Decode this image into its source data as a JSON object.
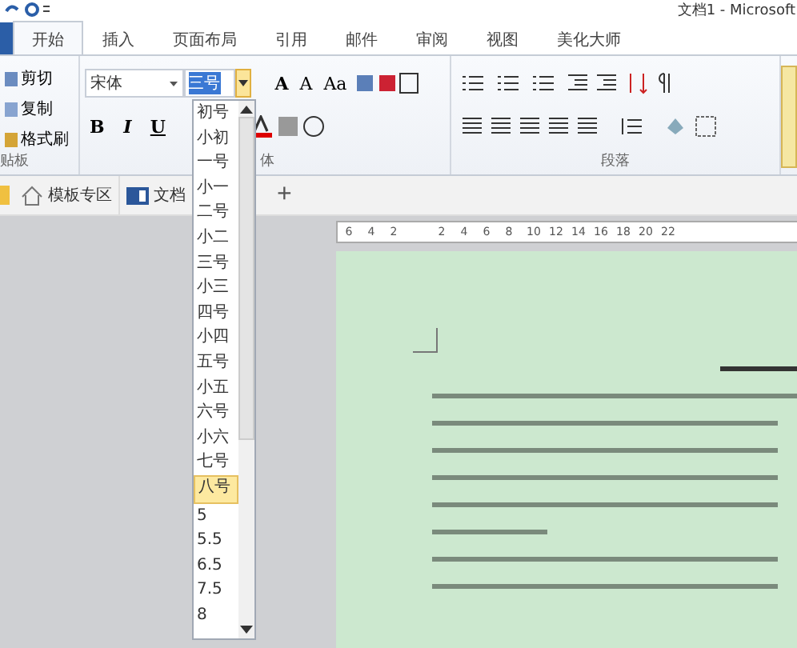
{
  "window": {
    "title": "文档1 - Microsoft"
  },
  "tabs": [
    {
      "label": "开始",
      "selected": true
    },
    {
      "label": "插入",
      "selected": false
    },
    {
      "label": "页面布局",
      "selected": false
    },
    {
      "label": "引用",
      "selected": false
    },
    {
      "label": "邮件",
      "selected": false
    },
    {
      "label": "审阅",
      "selected": false
    },
    {
      "label": "视图",
      "selected": false
    },
    {
      "label": "美化大师",
      "selected": false
    }
  ],
  "clipboard": {
    "items": [
      "剪切",
      "复制",
      "格式刷"
    ],
    "group_label": "贴板"
  },
  "font": {
    "name": "宋体",
    "size": "三号",
    "row1_tools": [
      "A",
      "A",
      "Aa"
    ],
    "row2_tools": [
      "B",
      "I",
      "U"
    ],
    "group_label": "体"
  },
  "paragraph": {
    "group_label": "段落"
  },
  "doc_tabs": [
    {
      "label": "模板专区",
      "kind": "home"
    },
    {
      "label": "文档",
      "kind": "word"
    }
  ],
  "new_tab": "+",
  "ruler": {
    "labels": [
      "6",
      "4",
      "2",
      "2",
      "4",
      "6",
      "8",
      "10",
      "12",
      "14",
      "16",
      "18",
      "20",
      "22"
    ]
  },
  "size_dropdown": {
    "items": [
      {
        "label": "初号",
        "selected": false
      },
      {
        "label": "小初",
        "selected": false
      },
      {
        "label": "一号",
        "selected": false
      },
      {
        "label": "小一",
        "selected": false
      },
      {
        "label": "二号",
        "selected": false
      },
      {
        "label": "小二",
        "selected": false
      },
      {
        "label": "三号",
        "selected": false
      },
      {
        "label": "小三",
        "selected": false
      },
      {
        "label": "四号",
        "selected": false
      },
      {
        "label": "小四",
        "selected": false
      },
      {
        "label": "五号",
        "selected": false
      },
      {
        "label": "小五",
        "selected": false
      },
      {
        "label": "六号",
        "selected": false
      },
      {
        "label": "小六",
        "selected": false
      },
      {
        "label": "七号",
        "selected": false
      },
      {
        "label": "八号",
        "selected": true
      },
      {
        "label": "5",
        "selected": false
      },
      {
        "label": "5.5",
        "selected": false
      },
      {
        "label": "6.5",
        "selected": false
      },
      {
        "label": "7.5",
        "selected": false
      },
      {
        "label": "8",
        "selected": false
      }
    ]
  }
}
